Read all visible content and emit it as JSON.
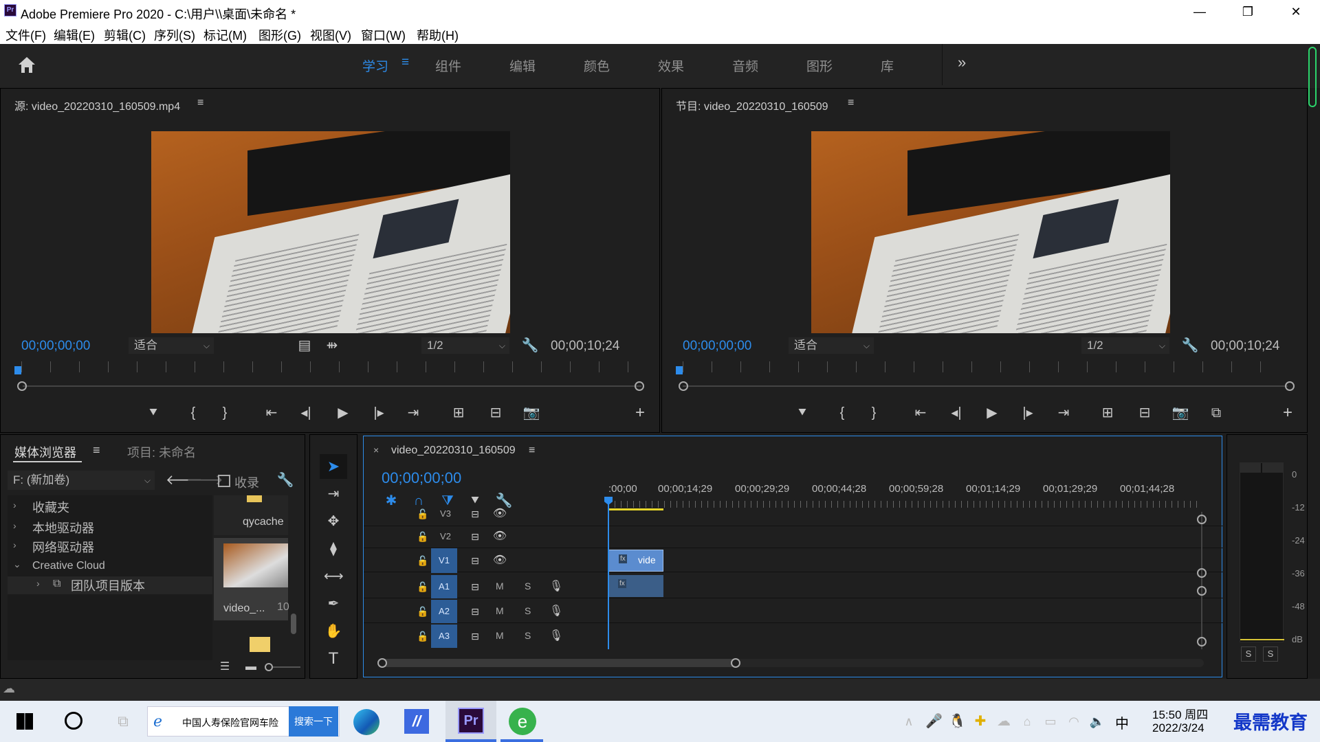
{
  "window": {
    "title": "Adobe Premiere Pro 2020 - C:\\用户\\\\桌面\\未命名 *",
    "app_icon": "Pr",
    "controls": [
      "—",
      "❐",
      "✕"
    ]
  },
  "menu": [
    "文件(F)",
    "编辑(E)",
    "剪辑(C)",
    "序列(S)",
    "标记(M)",
    "图形(G)",
    "视图(V)",
    "窗口(W)",
    "帮助(H)"
  ],
  "workspaces": {
    "tabs": [
      "学习",
      "组件",
      "编辑",
      "颜色",
      "效果",
      "音频",
      "图形",
      "库"
    ],
    "active": "学习",
    "more": "»",
    "menu_glyph": "≡"
  },
  "source_monitor": {
    "title": "源: video_20220310_160509.mp4",
    "menu_glyph": "≡",
    "timecode": "00;00;00;00",
    "fit": "适合",
    "resolution": "1/2",
    "duration": "00;00;10;24",
    "add_glyph": "+"
  },
  "program_monitor": {
    "title": "节目: video_20220310_160509",
    "menu_glyph": "≡",
    "timecode": "00;00;00;00",
    "fit": "适合",
    "resolution": "1/2",
    "duration": "00;00;10;24",
    "add_glyph": "+"
  },
  "media_browser": {
    "tab": "媒体浏览器",
    "tab_menu": "≡",
    "project_tab": "项目: 未命名",
    "drive": "F: (新加卷)",
    "favorites_checkbox": "收录",
    "tree": [
      {
        "label": "收藏夹",
        "arrow": "›"
      },
      {
        "label": "本地驱动器",
        "arrow": "›"
      },
      {
        "label": "网络驱动器",
        "arrow": "›"
      },
      {
        "label": "Creative Cloud",
        "arrow": "⌄"
      },
      {
        "label": "团队项目版本",
        "arrow": "›"
      }
    ],
    "files": [
      {
        "name": "qycache"
      },
      {
        "name": "video_...",
        "extra": "10"
      }
    ]
  },
  "timeline": {
    "sequence_name": "video_20220310_160509",
    "menu_glyph": "≡",
    "close_glyph": "×",
    "timecode": "00;00;00;00",
    "ruler": [
      ":00;00",
      "00;00;14;29",
      "00;00;29;29",
      "00;00;44;28",
      "00;00;59;28",
      "00;01;14;29",
      "00;01;29;29",
      "00;01;44;28"
    ],
    "video_tracks": [
      "V3",
      "V2",
      "V1"
    ],
    "audio_tracks": [
      "A1",
      "A2",
      "A3"
    ],
    "mute_label": "M",
    "solo_label": "S",
    "clip_label": "vide",
    "fx_label": "fx"
  },
  "audio_meter": {
    "scale": [
      "0",
      "-12",
      "-24",
      "-36",
      "-48",
      "dB"
    ],
    "solo_buttons": [
      "S",
      "S"
    ]
  },
  "taskbar": {
    "ie_tab": "中国人寿保险官网车险",
    "search_button": "搜索一下",
    "pr_label": "Pr",
    "time": "15:50 周四",
    "date": "2022/3/24",
    "ime": "中",
    "watermark": "最需教育"
  },
  "colors": {
    "accent": "#2d8ceb",
    "track_active": "#2d5d97",
    "clip": "#5b8ccf",
    "playhead": "#2d8ceb"
  }
}
